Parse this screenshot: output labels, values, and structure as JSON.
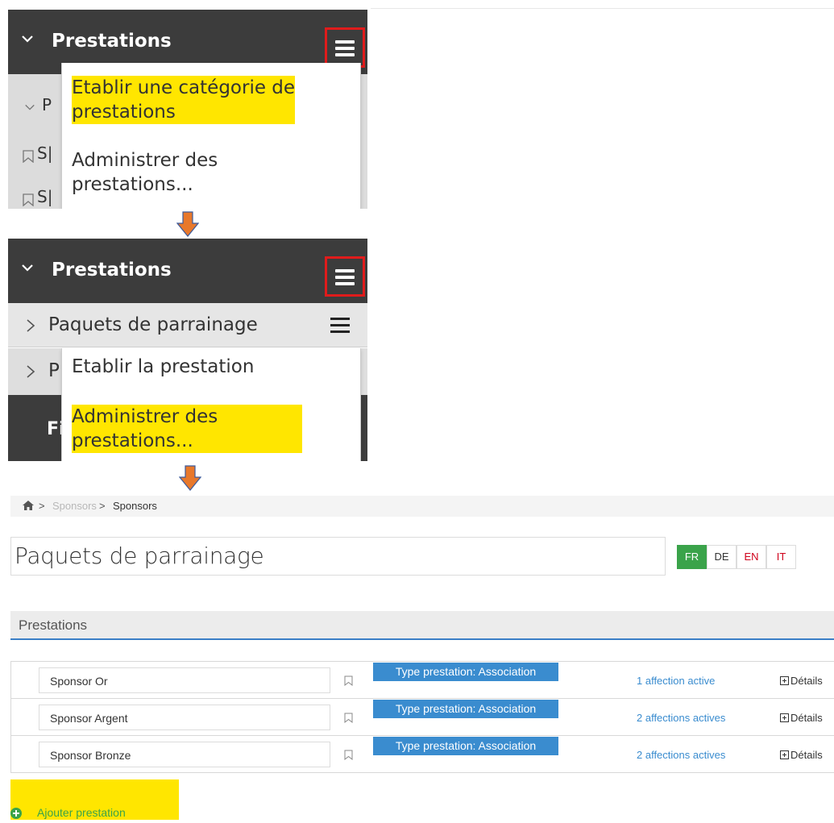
{
  "step1": {
    "header_title": "Prestations",
    "row_fragments": [
      "P",
      "S|",
      "S|"
    ],
    "menu_items": [
      {
        "line1": "Etablir une catégorie de",
        "line2": "prestations",
        "highlighted": true
      },
      {
        "line1": "Administrer des",
        "line2": "prestations...",
        "highlighted": false
      }
    ]
  },
  "step2": {
    "header_title": "Prestations",
    "row1_label": "Paquets de parrainage",
    "row2_fragment": "P",
    "row3_fragment": "Fi",
    "menu_items": [
      {
        "line1": "Etablir la prestation",
        "line2": "",
        "highlighted": false
      },
      {
        "line1": "Administrer des",
        "line2": "prestations...",
        "highlighted": true
      }
    ]
  },
  "breadcrumb": {
    "items": [
      "Sponsors",
      "Sponsors"
    ],
    "separator": ">"
  },
  "page": {
    "title": "Paquets de parrainage",
    "languages": [
      {
        "code": "FR",
        "active": true
      },
      {
        "code": "DE",
        "active": false
      },
      {
        "code": "EN",
        "active": false
      },
      {
        "code": "IT",
        "active": false
      }
    ]
  },
  "section": {
    "title": "Prestations",
    "rows": [
      {
        "name": "Sponsor Or",
        "type": "Type prestation: Association",
        "affections": "1 affection active",
        "details": "Détails"
      },
      {
        "name": "Sponsor Argent",
        "type": "Type prestation: Association",
        "affections": "2 affections actives",
        "details": "Détails"
      },
      {
        "name": "Sponsor Bronze",
        "type": "Type prestation: Association",
        "affections": "2 affections actives",
        "details": "Détails"
      }
    ],
    "add_label": "Ajouter prestation"
  },
  "colors": {
    "dark_header": "#3c3c3c",
    "highlight": "#ffe600",
    "accent_blue": "#3a8ccf",
    "active_green": "#3aa34a",
    "lang_red": "#d0021b",
    "marker_red": "#e01b1b",
    "arrow_orange": "#e8782b"
  }
}
